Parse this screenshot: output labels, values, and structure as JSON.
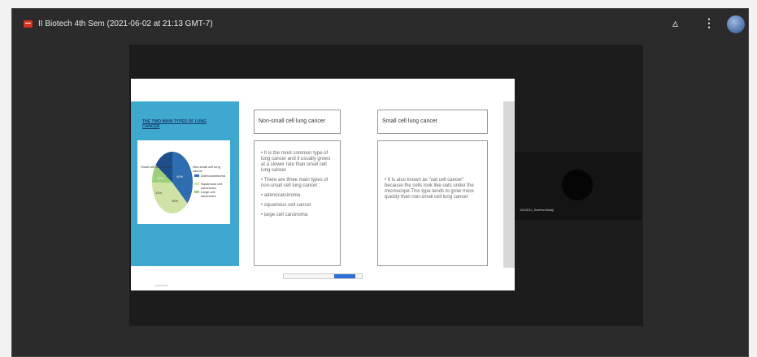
{
  "meeting": {
    "title": "II Biotech 4th Sem (2021-06-02 at 21:13 GMT-7)",
    "icons": [
      "record-icon",
      "drive-icon",
      "more-vert-icon",
      "user-avatar"
    ]
  },
  "slide": {
    "panel_title": "THE TWO MAIN TYPES OF LUNG CANCER",
    "pie": {
      "slices": [
        "40%",
        "35%",
        "13%",
        "12%"
      ],
      "colors": [
        "#2e6db0",
        "#cfe3a6",
        "#9fcf7a",
        "#1e4e8c"
      ],
      "side_labels": [
        "Small cell lung cancer",
        "Non-small cell lung cancer"
      ],
      "legend": [
        "Adenocarcinoma",
        "Squamous cell carcinoma",
        "Large cell carcinoma"
      ]
    },
    "left_box": {
      "title": "Non-small cell lung cancer",
      "bullets": [
        "It is the most common type of lung cancer and it usually grows at a slower rate than small cell lung cancer",
        "There are three main types of non-small cell lung cancer :",
        "adenocarcinoma",
        "squamous cell cancer",
        "large cell carcinoma"
      ]
    },
    "right_box": {
      "title": "Small cell lung cancer",
      "text": "It is also known as \"oat cell cancer\" because the cells look like oats under the microscope.This type tends to grow more quickly than non-small cell lung cancer"
    }
  },
  "participant": {
    "name": "1924011_Swetha Balaji"
  }
}
